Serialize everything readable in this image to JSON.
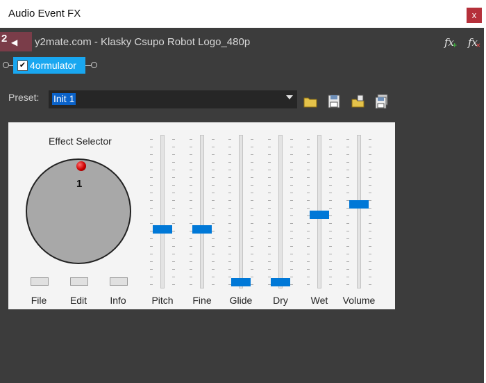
{
  "window": {
    "title": "Audio Event FX",
    "close_glyph": "x"
  },
  "track": {
    "number": "2",
    "name": "y2mate.com - Klasky Csupo Robot Logo_480p"
  },
  "fx_buttons": [
    {
      "name": "fx-add-icon",
      "glyph": "fx"
    },
    {
      "name": "fx-remove-icon",
      "glyph": "fx"
    }
  ],
  "plugin_chain": {
    "plugin_label": "4ormulator",
    "enabled": true
  },
  "preset": {
    "label": "Preset:",
    "value": "Init 1"
  },
  "toolbar_icons": [
    "folder-open-icon",
    "save-preset-icon",
    "copy-preset-icon",
    "save-all-icon"
  ],
  "effect": {
    "title": "Effect Selector",
    "selector_value": "1",
    "buttons": [
      "File",
      "Edit",
      "Info"
    ],
    "sliders": [
      {
        "label": "Pitch",
        "value": 0.5
      },
      {
        "label": "Fine",
        "value": 0.5
      },
      {
        "label": "Glide",
        "value": 0.0
      },
      {
        "label": "Dry",
        "value": 0.0
      },
      {
        "label": "Wet",
        "value": 0.64
      },
      {
        "label": "Volume",
        "value": 0.74
      }
    ]
  },
  "colors": {
    "accent": "#0078d7",
    "chip": "#19a7f0",
    "track_badge": "#7a3d49",
    "close": "#b5303a"
  }
}
